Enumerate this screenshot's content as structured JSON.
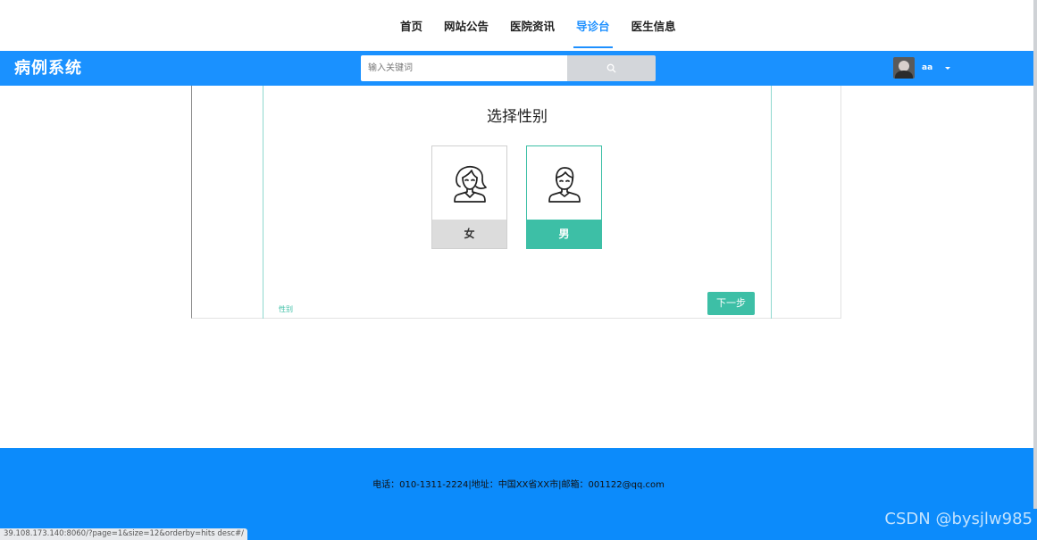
{
  "topnav": {
    "items": [
      {
        "label": "首页",
        "active": false
      },
      {
        "label": "网站公告",
        "active": false
      },
      {
        "label": "医院资讯",
        "active": false
      },
      {
        "label": "导诊台",
        "active": true
      },
      {
        "label": "医生信息",
        "active": false
      }
    ]
  },
  "header": {
    "brand": "病例系统",
    "search": {
      "placeholder": "输入关键词",
      "value": ""
    },
    "search_icon": "search-icon",
    "user": {
      "name": "aa",
      "avatar_icon": "avatar-image",
      "caret_icon": "caret-down-icon"
    },
    "bar_color": "#1a91ff"
  },
  "main": {
    "title": "选择性别",
    "options": [
      {
        "label": "女",
        "icon": "female-person-icon",
        "selected": false
      },
      {
        "label": "男",
        "icon": "male-person-icon",
        "selected": true
      }
    ],
    "step_caption": "性别",
    "next_label": "下一步",
    "accent_color": "#3dbfa6"
  },
  "footer": {
    "text": "电话：010-1311-2224|地址：中国XX省XX市|邮箱：001122@qq.com",
    "color": "#0c8bfb"
  },
  "statusbar": {
    "url": "39.108.173.140:8060/?page=1&size=12&orderby=hits desc#/"
  },
  "watermark": "CSDN @bysjlw985"
}
